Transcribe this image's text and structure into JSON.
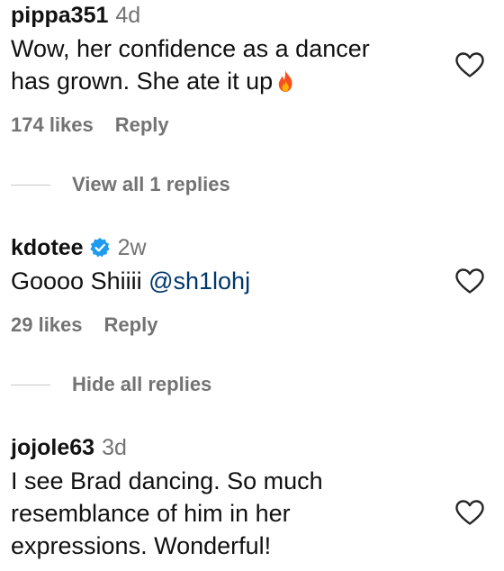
{
  "comments": [
    {
      "username": "pippa351",
      "time": "4d",
      "verified": false,
      "lines": [
        "Wow, her confidence as a dancer",
        "has grown. She ate it up"
      ],
      "emoji": "fire",
      "likes": "174 likes",
      "reply_label": "Reply",
      "replies_toggle": "View all 1 replies"
    },
    {
      "username": "kdotee",
      "time": "2w",
      "verified": true,
      "text_prefix": "Goooo Shiiii ",
      "mention": "@sh1lohj",
      "likes": "29 likes",
      "reply_label": "Reply",
      "replies_toggle": "Hide all replies"
    },
    {
      "username": "jojole63",
      "time": "3d",
      "verified": false,
      "lines": [
        "I see Brad dancing. So much",
        "resemblance of him in her",
        "expressions. Wonderful!"
      ]
    }
  ],
  "icons": {
    "like": "heart-outline-icon",
    "verified": "verified-badge-icon",
    "emoji": "fire-emoji-icon"
  },
  "colors": {
    "text": "#111111",
    "secondary": "#737373",
    "mention": "#00376b",
    "verified": "#1d9bf0",
    "divider": "#c7c7c7"
  }
}
